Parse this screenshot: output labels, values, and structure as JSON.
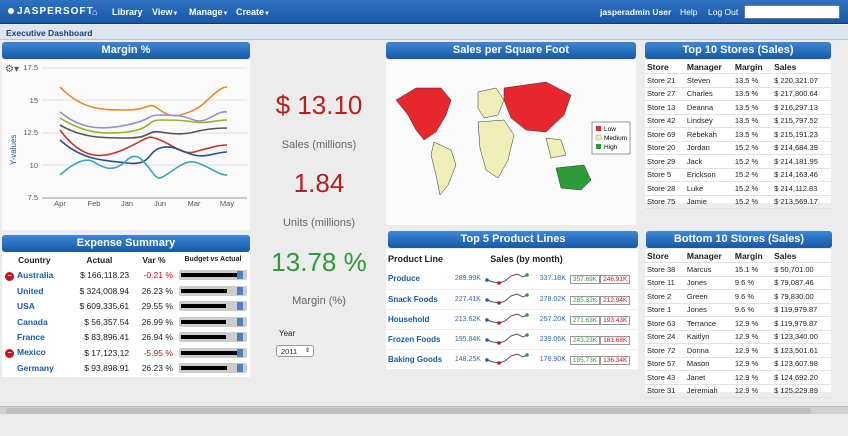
{
  "header": {
    "logo": "JASPERSOFT",
    "nav": [
      "Library",
      "View",
      "Manage",
      "Create"
    ],
    "user": "jasperadmin User",
    "help": "Help",
    "logout": "Log Out"
  },
  "dashboard": {
    "title": "Executive Dashboard"
  },
  "margin_chart": {
    "title": "Margin %",
    "ylabel": "Y-values",
    "yticks": [
      "17.5",
      "15",
      "12.5",
      "10",
      "7.5"
    ],
    "xticks": [
      "Apr",
      "Feb",
      "Jan",
      "Jun",
      "Mar",
      "May"
    ]
  },
  "kpi": {
    "sales_value": "$ 13.10",
    "sales_label": "Sales (millions)",
    "units_value": "1.84",
    "units_label": "Units (millions)",
    "margin_value": "13.78 %",
    "margin_label": "Margin (%)",
    "year_label": "Year",
    "year_value": "2011"
  },
  "map": {
    "title": "Sales per Square Foot",
    "legend": [
      "Low",
      "Medium",
      "High"
    ],
    "colors": {
      "low": "#e8262e",
      "medium": "#efeeb8",
      "high": "#2d9b3a"
    }
  },
  "expense": {
    "title": "Expense Summary",
    "headers": [
      "Country",
      "Actual",
      "Var %",
      "Budget vs Actual"
    ],
    "rows": [
      {
        "country": "Australia",
        "actual": "$ 166,118.23",
        "var": "-0.21 %",
        "neg": true,
        "fill": 0.93
      },
      {
        "country": "United",
        "actual": "$ 324,008.94",
        "var": "26.23 %",
        "neg": false,
        "fill": 0.77
      },
      {
        "country": "USA",
        "actual": "$ 609,335.61",
        "var": "29.55 %",
        "neg": false,
        "fill": 0.75
      },
      {
        "country": "Canada",
        "actual": "$ 56,357.54",
        "var": "26.99 %",
        "neg": false,
        "fill": 0.76
      },
      {
        "country": "France",
        "actual": "$ 83,896.41",
        "var": "26.94 %",
        "neg": false,
        "fill": 0.76
      },
      {
        "country": "Mexico",
        "actual": "$ 17,123.12",
        "var": "-5.95 %",
        "neg": true,
        "fill": 0.98
      },
      {
        "country": "Germany",
        "actual": "$ 93,898.91",
        "var": "26.23 %",
        "neg": false,
        "fill": 0.77
      }
    ]
  },
  "products": {
    "title": "Top 5 Product Lines",
    "headers": [
      "Product Line",
      "Sales (by month)"
    ],
    "rows": [
      {
        "name": "Produce",
        "start": "289.99K",
        "end": "337.18K",
        "max": "357.69K",
        "min": "246.91K"
      },
      {
        "name": "Snack Foods",
        "start": "227.41K",
        "end": "278.02K",
        "max": "285.32K",
        "min": "212.94K"
      },
      {
        "name": "Household",
        "start": "213.62K",
        "end": "257.20K",
        "max": "271.63K",
        "min": "193.43K"
      },
      {
        "name": "Frozen Foods",
        "start": "195.84K",
        "end": "239.06K",
        "max": "243.23K",
        "min": "181.68K"
      },
      {
        "name": "Baking Goods",
        "start": "148.25K",
        "end": "178.90K",
        "max": "185.73K",
        "min": "136.34K"
      }
    ]
  },
  "top10": {
    "title": "Top 10 Stores (Sales)",
    "headers": [
      "Store",
      "Manager",
      "Margin",
      "Sales"
    ],
    "rows": [
      [
        "Store 21",
        "Steven",
        "13.5 %",
        "$ 220,321.07"
      ],
      [
        "Store 27",
        "Charles",
        "13.5 %",
        "$ 217,800.64"
      ],
      [
        "Store 13",
        "Deanna",
        "13.5 %",
        "$ 216,297.13"
      ],
      [
        "Store 42",
        "Lindsey",
        "13.5 %",
        "$ 215,797.52"
      ],
      [
        "Store 69",
        "Rebekah",
        "13.5 %",
        "$ 215,191.23"
      ],
      [
        "Store 20",
        "Jordan",
        "15.2 %",
        "$ 214,684.39"
      ],
      [
        "Store 29",
        "Jack",
        "15.2 %",
        "$ 214,181.95"
      ],
      [
        "Store 5",
        "Erickson",
        "15.2 %",
        "$ 214,163.46"
      ],
      [
        "Store 28",
        "Luke",
        "15.2 %",
        "$ 214,112.83"
      ],
      [
        "Store 75",
        "Jamie",
        "15.2 %",
        "$ 213,569.17"
      ]
    ]
  },
  "bottom10": {
    "title": "Bottom 10 Stores (Sales)",
    "headers": [
      "Store",
      "Manager",
      "Margin",
      "Sales"
    ],
    "rows": [
      [
        "Store 38",
        "Marcus",
        "15.1 %",
        "$ 50,701.00"
      ],
      [
        "Store 11",
        "Jones",
        "9.6 %",
        "$ 79,087.46"
      ],
      [
        "Store 2",
        "Green",
        "9.6 %",
        "$ 79,830.00"
      ],
      [
        "Store 1",
        "Jones",
        "9.6 %",
        "$ 119,979.87"
      ],
      [
        "Store 63",
        "Terrance",
        "12.9 %",
        "$ 119,979.87"
      ],
      [
        "Store 24",
        "Kaitlyn",
        "12.9 %",
        "$ 123,340.00"
      ],
      [
        "Store 72",
        "Donna",
        "12.9 %",
        "$ 123,501.61"
      ],
      [
        "Store 57",
        "Mason",
        "12.9 %",
        "$ 123,607.98"
      ],
      [
        "Store 43",
        "Janet",
        "12.9 %",
        "$ 124,692.20"
      ],
      [
        "Store 31",
        "Jeremiah",
        "12.9 %",
        "$ 125,229.89"
      ]
    ]
  }
}
